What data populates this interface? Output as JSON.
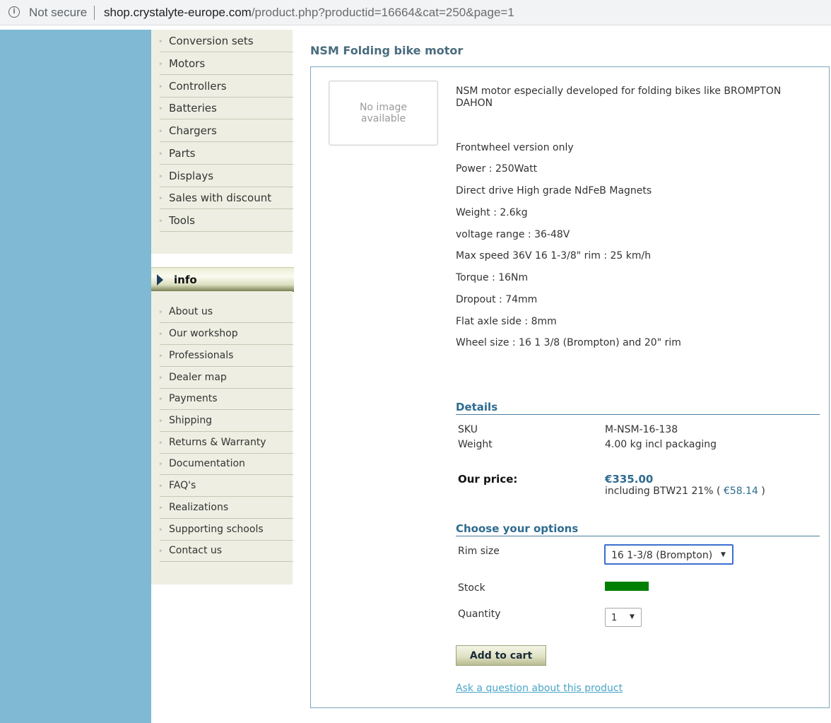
{
  "browser": {
    "security_text": "Not secure",
    "url_host": "shop.crystalyte-europe.com",
    "url_path": "/product.php?productid=16664&cat=250&page=1"
  },
  "sidebar": {
    "categories": [
      "Conversion sets",
      "Motors",
      "Controllers",
      "Batteries",
      "Chargers",
      "Parts",
      "Displays",
      "Sales with discount",
      "Tools"
    ],
    "info_title": "info",
    "info_items": [
      "About us",
      "Our workshop",
      "Professionals",
      "Dealer map",
      "Payments",
      "Shipping",
      "Returns & Warranty",
      "Documentation",
      "FAQ's",
      "Realizations",
      "Supporting schools",
      "Contact us"
    ]
  },
  "product": {
    "title": "NSM Folding bike motor",
    "no_image_text": "No image available",
    "description_intro": "NSM motor especially developed for folding bikes like BROMPTON DAHON",
    "description_lines": [
      "Frontwheel version only",
      "Power : 250Watt",
      "Direct drive High grade NdFeB Magnets",
      "Weight : 2.6kg",
      "voltage range : 36-48V",
      "Max speed 36V 16 1-3/8\" rim : 25 km/h",
      "Torque : 16Nm",
      "Dropout : 74mm",
      "Flat axle side : 8mm",
      "Wheel size : 16 1 3/8 (Brompton) and 20\" rim"
    ],
    "details_heading": "Details",
    "sku_label": "SKU",
    "sku_value": "M-NSM-16-138",
    "weight_label": "Weight",
    "weight_value": "4.00 kg incl packaging",
    "price_label": "Our price:",
    "price_value": "€335.00",
    "tax_prefix": "including BTW21 21% ( ",
    "tax_amount": "€58.14",
    "tax_suffix": " )",
    "options_heading": "Choose your options",
    "rim_label": "Rim size",
    "rim_value": "16 1-3/8 (Brompton)",
    "stock_label": "Stock",
    "stock_color": "#008000",
    "quantity_label": "Quantity",
    "quantity_value": "1",
    "add_to_cart": "Add to cart",
    "ask_question": "Ask a question about this product"
  }
}
